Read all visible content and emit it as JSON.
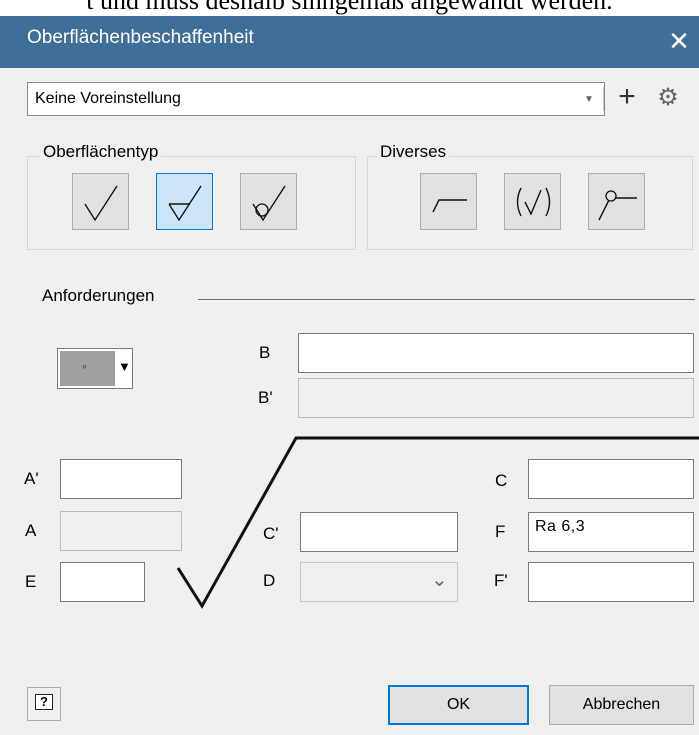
{
  "background_text": "t und muss deshalb sinngemäß angewandt werden.",
  "window": {
    "title": "Oberflächenbeschaffenheit",
    "close_glyph": "✕"
  },
  "preset": {
    "value": "Keine Voreinstellung",
    "caret": "▼",
    "add_glyph": "+",
    "settings_glyph": "⚙"
  },
  "surface_type": {
    "label": "Oberflächentyp",
    "selected_index": 1
  },
  "misc": {
    "label": "Diverses"
  },
  "requirements": {
    "label": "Anforderungen",
    "lay_symbol": "◦",
    "lay_caret": "▼"
  },
  "fields": {
    "B": {
      "label": "B",
      "value": ""
    },
    "B_prime": {
      "label": "B'",
      "value": ""
    },
    "A_prime": {
      "label": "A'",
      "value": ""
    },
    "A": {
      "label": "A",
      "value": ""
    },
    "E": {
      "label": "E",
      "value": ""
    },
    "C_prime": {
      "label": "C'",
      "value": ""
    },
    "D": {
      "label": "D",
      "value": "",
      "caret": "⌄"
    },
    "C": {
      "label": "C",
      "value": ""
    },
    "F": {
      "label": "F",
      "value": "Ra 6,3"
    },
    "F_prime": {
      "label": "F'",
      "value": ""
    }
  },
  "footer": {
    "help_glyph": "?",
    "ok_label": "OK",
    "cancel_label": "Abbrechen"
  },
  "colors": {
    "titlebar": "#3f6e98",
    "accent": "#0078d7",
    "selected_fill": "#cce4f7"
  }
}
